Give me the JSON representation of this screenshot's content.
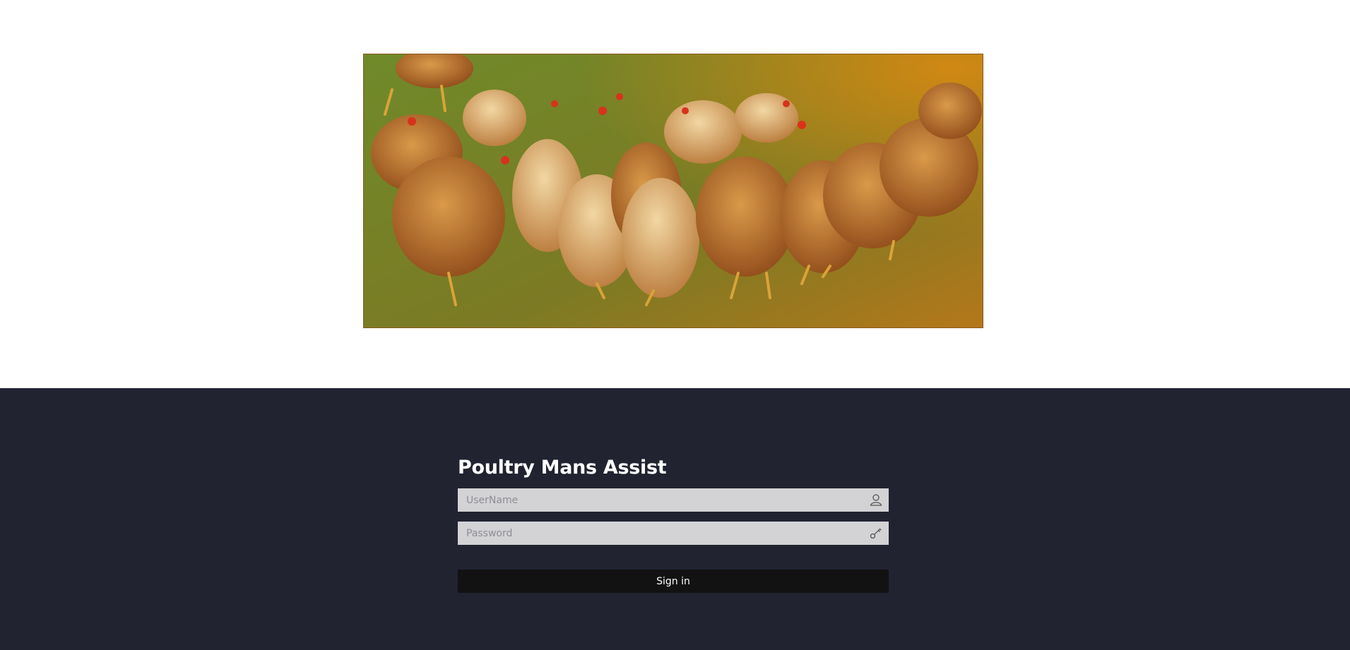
{
  "login": {
    "title": "Poultry Mans Assist",
    "username_placeholder": "UserName",
    "password_placeholder": "Password",
    "signin_label": "Sign in"
  },
  "icons": {
    "username": "user-icon",
    "password": "key-icon"
  },
  "colors": {
    "panel_background": "#212331",
    "input_background": "#d3d3d6",
    "button_background": "#121212",
    "title_color": "#ffffff"
  }
}
